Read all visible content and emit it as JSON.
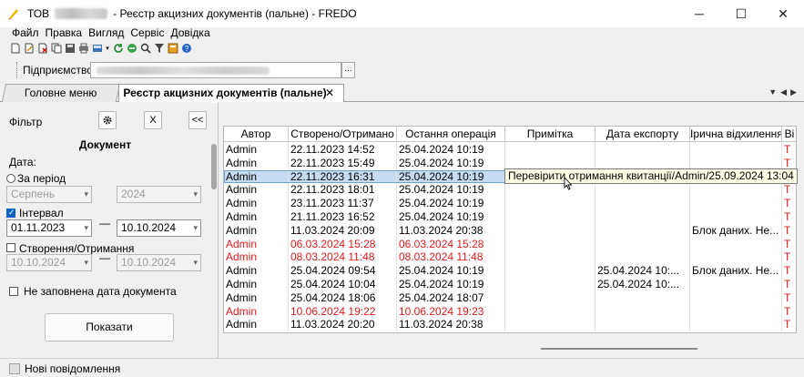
{
  "window": {
    "title_company": "ТОВ",
    "title_rest": "- Реєстр акцизних документів (пальне) - FREDO",
    "buttons": [
      "─",
      "☐",
      "✕"
    ]
  },
  "menu": [
    "Файл",
    "Правка",
    "Вигляд",
    "Сервіс",
    "Довідка"
  ],
  "enterprise": {
    "label": "Підприємство",
    "browse": "..."
  },
  "tabs": {
    "home": "Головне меню",
    "active": "Реєстр акцизних документів (пальне)",
    "close": "✕",
    "nav": [
      "▼",
      "◀",
      "▶"
    ]
  },
  "filter": {
    "label": "Фільтр",
    "settings_icon": "gear-icon",
    "clear": "X",
    "collapse": "<<",
    "document_title": "Документ",
    "date_label": "Дата:",
    "period_label": "За період",
    "period_month": "Серпень",
    "period_year": "2024",
    "interval_label": "Інтервал",
    "interval_from": "01.11.2023",
    "interval_to": "10.10.2024",
    "created_label": "Створення/Отримання",
    "created_from": "10.10.2024",
    "created_to": "10.10.2024",
    "empty_date_label": "Не заповнена дата документа",
    "show_button": "Показати"
  },
  "grid": {
    "columns": [
      "Автор",
      "Створено/Отримано",
      "Остання операція",
      "Примітка",
      "Дата експорту",
      "Ірична відхилення",
      "Ві"
    ],
    "rows": [
      {
        "author": "Admin",
        "created": "22.11.2023 14:52",
        "last_op": "25.04.2024 10:19",
        "note": "",
        "export": "",
        "reason": "",
        "extra": "Т",
        "red": false,
        "selected": false
      },
      {
        "author": "Admin",
        "created": "22.11.2023 15:49",
        "last_op": "25.04.2024 10:19",
        "note": "",
        "export": "",
        "reason": "",
        "extra": "Т",
        "red": false,
        "selected": false
      },
      {
        "author": "Admin",
        "created": "22.11.2023 16:31",
        "last_op": "25.04.2024 10:19",
        "note": "",
        "export": "",
        "reason": "",
        "extra": "Т",
        "red": false,
        "selected": true
      },
      {
        "author": "Admin",
        "created": "22.11.2023 18:01",
        "last_op": "25.04.2024 10:19",
        "note": "",
        "export": "",
        "reason": "",
        "extra": "Т",
        "red": false,
        "selected": false
      },
      {
        "author": "Admin",
        "created": "23.11.2023 11:37",
        "last_op": "25.04.2024 10:19",
        "note": "",
        "export": "",
        "reason": "",
        "extra": "Т",
        "red": false,
        "selected": false
      },
      {
        "author": "Admin",
        "created": "21.11.2023 16:52",
        "last_op": "25.04.2024 10:19",
        "note": "",
        "export": "",
        "reason": "",
        "extra": "Т",
        "red": false,
        "selected": false
      },
      {
        "author": "Admin",
        "created": "11.03.2024 20:09",
        "last_op": "11.03.2024 20:38",
        "note": "",
        "export": "",
        "reason": "Блок даних. Не...",
        "extra": "Т",
        "red": false,
        "selected": false
      },
      {
        "author": "Admin",
        "created": "06.03.2024 15:28",
        "last_op": "06.03.2024 15:28",
        "note": "",
        "export": "",
        "reason": "",
        "extra": "Т",
        "red": true,
        "selected": false
      },
      {
        "author": "Admin",
        "created": "08.03.2024 11:48",
        "last_op": "08.03.2024 11:48",
        "note": "",
        "export": "",
        "reason": "",
        "extra": "Т",
        "red": true,
        "selected": false
      },
      {
        "author": "Admin",
        "created": "25.04.2024 09:54",
        "last_op": "25.04.2024 10:19",
        "note": "",
        "export": "25.04.2024 10:...",
        "reason": "Блок даних. Не...",
        "extra": "Т",
        "red": false,
        "selected": false
      },
      {
        "author": "Admin",
        "created": "25.04.2024 10:04",
        "last_op": "25.04.2024 10:19",
        "note": "",
        "export": "25.04.2024 10:...",
        "reason": "",
        "extra": "Т",
        "red": false,
        "selected": false
      },
      {
        "author": "Admin",
        "created": "25.04.2024 18:06",
        "last_op": "25.04.2024 18:07",
        "note": "",
        "export": "",
        "reason": "",
        "extra": "Т",
        "red": false,
        "selected": false
      },
      {
        "author": "Admin",
        "created": "10.06.2024 19:22",
        "last_op": "10.06.2024 19:23",
        "note": "",
        "export": "",
        "reason": "",
        "extra": "Т",
        "red": true,
        "selected": false
      },
      {
        "author": "Admin",
        "created": "11.03.2024 20:20",
        "last_op": "11.03.2024 20:38",
        "note": "",
        "export": "",
        "reason": "",
        "extra": "Т",
        "red": false,
        "selected": false
      }
    ]
  },
  "tooltip": "Перевірити отримання квитанції/Admin/25.09.2024 13:04",
  "status": {
    "label": "Нові повідомлення"
  },
  "colors": {
    "accent": "#0b63c7",
    "error_text": "#e21b1b",
    "selection": "#c6dcf2"
  }
}
